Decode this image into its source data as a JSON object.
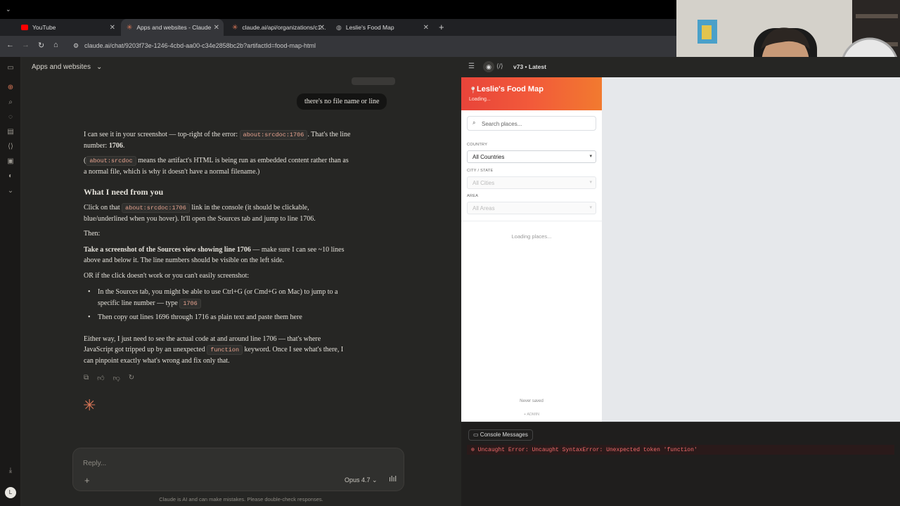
{
  "browser": {
    "tabs": [
      {
        "label": "YouTube",
        "color": "#ff0000"
      },
      {
        "label": "Apps and websites - Claude",
        "color": "#d97757"
      },
      {
        "label": "claude.ai/api/organizations/c1...",
        "color": "#d97757"
      },
      {
        "label": "Leslie's Food Map",
        "color": "#8a8a8a"
      }
    ],
    "url": "claude.ai/chat/9203f73e-1246-4cbd-aa00-c34e2858bc2b?artifactId=food-map-html"
  },
  "chat": {
    "title": "Apps and websites",
    "user_message": "there's no file name or line",
    "p1_a": "I can see it in your screenshot — top-right of the error: ",
    "p1_code": "about:srcdoc:1706",
    "p1_b": ". That's the line",
    "p1_c": "number: ",
    "p1_strong": "1706",
    "p1_d": ".",
    "p2_a": "(",
    "p2_code": "about:srcdoc",
    "p2_b": " means the artifact's HTML is being run as embedded content rather than as",
    "p2_c": "a normal file, which is why it doesn't have a normal filename.)",
    "heading": "What I need from you",
    "p3_a": "Click on that ",
    "p3_code": "about:srcdoc:1706",
    "p3_b": " link in the console (it should be clickable,",
    "p3_c": "blue/underlined when you hover). It'll open the Sources tab and jump to line 1706.",
    "p4": "Then:",
    "p5_strong": "Take a screenshot of the Sources view showing line 1706",
    "p5_a": " — make sure I can see ~10 lines",
    "p5_b": "above and below it. The line numbers should be visible on the left side.",
    "p6": "OR if the click doesn't work or you can't easily screenshot:",
    "bullet1_a": "In the Sources tab, you might be able to use Ctrl+G (or Cmd+G on Mac) to jump to a",
    "bullet1_b": "specific line number — type ",
    "bullet1_code": "1706",
    "bullet2": "Then copy out lines 1696 through 1716 as plain text and paste them here",
    "p7_a": "Either way, I just need to see the actual code at and around line 1706 — that's where",
    "p7_b": "JavaScript got tripped up by an unexpected ",
    "p7_code": "function",
    "p7_c": " keyword. Once I see what's there, I",
    "p7_d": "can pinpoint exactly what's wrong and fix only that.",
    "reply_placeholder": "Reply...",
    "model": "Opus 4.7",
    "disclaimer": "Claude is AI and can make mistakes. Please double-check responses.",
    "avatar_letter": "L"
  },
  "artifact": {
    "version": "v73 • Latest",
    "app_title": "Leslie's Food Map",
    "app_status": "Loading...",
    "search_placeholder": "Search places...",
    "country_label": "COUNTRY",
    "country_value": "All Countries",
    "city_label": "CITY / STATE",
    "city_value": "All Cities",
    "area_label": "AREA",
    "area_value": "All Areas",
    "loading_places": "Loading places...",
    "never_saved": "Never saved",
    "admin": "+ ADMIN"
  },
  "console": {
    "button": "Console Messages",
    "error": "Uncaught Error: Uncaught SyntaxError: Unexpected token 'function'"
  }
}
